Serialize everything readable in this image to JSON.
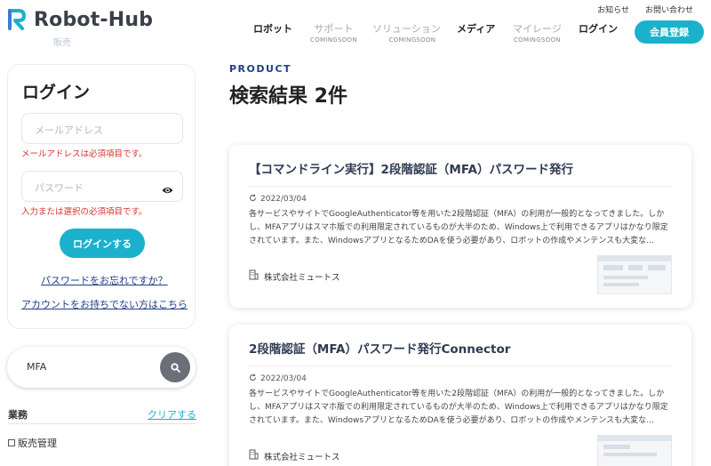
{
  "header": {
    "logo_text": "Robot-Hub",
    "logo_sub": "販売",
    "util_links": [
      "お知らせ",
      "お問い合わせ"
    ],
    "nav": [
      {
        "label": "ロボット",
        "sub": ""
      },
      {
        "label": "サポート",
        "sub": "COMINGSOON"
      },
      {
        "label": "ソリューション",
        "sub": "COMINGSOON"
      },
      {
        "label": "メディア",
        "sub": ""
      },
      {
        "label": "マイレージ",
        "sub": "COMINGSOON"
      },
      {
        "label": "ログイン",
        "sub": ""
      }
    ],
    "signup_label": "会員登録",
    "accent": "#1bb1cc"
  },
  "sidebar": {
    "login": {
      "title": "ログイン",
      "email_placeholder": "メールアドレス",
      "email_error": "メールアドレスは必須項目です。",
      "password_placeholder": "パスワード",
      "password_error": "入力または選択の必須項目です。",
      "submit_label": "ログインする",
      "forgot_link": "パスワードをお忘れですか？",
      "register_link": "アカウントをお持ちでない方はこちら"
    },
    "search": {
      "value": "MFA"
    },
    "filter": {
      "label": "業務",
      "clear_label": "クリアする",
      "items": [
        {
          "label": "販売管理",
          "checked": false
        }
      ]
    }
  },
  "main": {
    "eyebrow": "PRODUCT",
    "title": "検索結果 2件",
    "results": [
      {
        "title": "【コマンドライン実行】2段階認証（MFA）パスワード発行",
        "date": "2022/03/04",
        "description": "各サービスやサイトでGoogleAuthenticator等を用いた2段階認証（MFA）の利用が一般的となってきました。しかし、MFAアプリはスマホ版での利用限定されているものが大半のため、Windows上で利用できるアプリはかなり限定されています。また、WindowsアプリとなるためDAを使う必要があり、ロボットの作成やメンテンスも大変な…",
        "company": "株式会社ミュートス"
      },
      {
        "title": "2段階認証（MFA）パスワード発行Connector",
        "date": "2022/03/04",
        "description": "各サービスやサイトでGoogleAuthenticator等を用いた2段階認証（MFA）の利用が一般的となってきました。しかし、MFAアプリはスマホ版での利用限定されているものが大半のため、Windows上で利用できるアプリはかなり限定されています。また、WindowsアプリとなるためDAを使う必要があり、ロボットの作成やメンテンスも大変な…",
        "company": "株式会社ミュートス"
      }
    ]
  }
}
